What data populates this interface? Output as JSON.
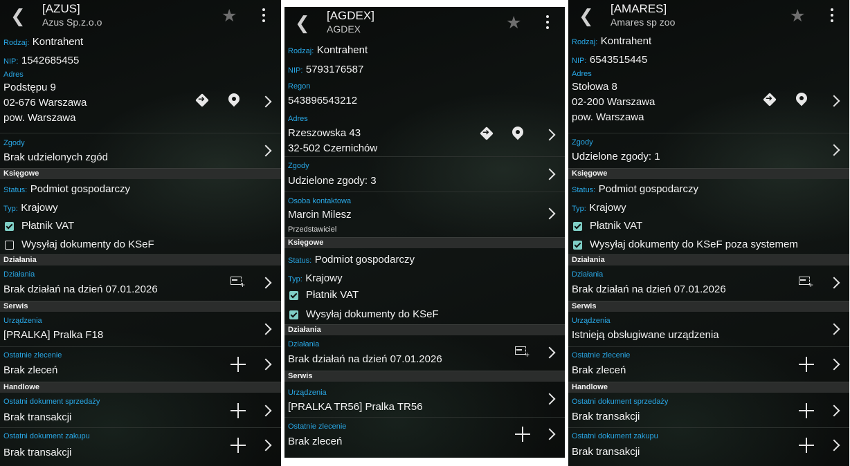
{
  "panels": [
    {
      "code": "[AZUS]",
      "name": "Azus Sp.z.o.o",
      "rodzaj_label": "Rodzaj:",
      "rodzaj": "Kontrahent",
      "nip_label": "NIP:",
      "nip": "1542685455",
      "adres_label": "Adres",
      "adres": [
        "Podstępu 9",
        "02-676 Warszawa",
        "pow. Warszawa"
      ],
      "zgody_label": "Zgody",
      "zgody": "Brak udzielonych zgód",
      "ksiegowe_header": "Księgowe",
      "status_label": "Status:",
      "status": "Podmiot gospodarczy",
      "typ_label": "Typ:",
      "typ": "Krajowy",
      "checkboxes": [
        {
          "label": "Płatnik VAT",
          "checked": true
        },
        {
          "label": "Wysyłaj dokumenty do KSeF",
          "checked": false
        }
      ],
      "dzialania_header": "Działania",
      "dzialania_label": "Działania",
      "dzialania": "Brak działań na dzień 07.01.2026",
      "serwis_header": "Serwis",
      "urzadzenia_label": "Urządzenia",
      "urzadzenia": "[PRALKA] Pralka F18",
      "zlecenie_label": "Ostatnie zlecenie",
      "zlecenie": "Brak zleceń",
      "handlowe_header": "Handlowe",
      "sprzedaz_label": "Ostatni dokument sprzedaży",
      "sprzedaz": "Brak transakcji",
      "zakup_label": "Ostatni dokument zakupu",
      "zakup": "Brak transakcji"
    },
    {
      "code": "[AGDEX]",
      "name": "AGDEX",
      "rodzaj_label": "Rodzaj:",
      "rodzaj": "Kontrahent",
      "nip_label": "NIP:",
      "nip": "5793176587",
      "regon_label": "Regon",
      "regon": "543896543212",
      "adres_label": "Adres",
      "adres": [
        "Rzeszowska 43",
        "32-502 Czernichów"
      ],
      "zgody_label": "Zgody",
      "zgody": "Udzielone zgody: 3",
      "osoba_label": "Osoba kontaktowa",
      "osoba": "Marcin Milesz",
      "osoba_rola": "Przedstawiciel",
      "ksiegowe_header": "Księgowe",
      "status_label": "Status:",
      "status": "Podmiot gospodarczy",
      "typ_label": "Typ:",
      "typ": "Krajowy",
      "checkboxes": [
        {
          "label": "Płatnik VAT",
          "checked": true
        },
        {
          "label": "Wysyłaj dokumenty do KSeF",
          "checked": true
        }
      ],
      "dzialania_header": "Działania",
      "dzialania_label": "Działania",
      "dzialania": "Brak działań na dzień 07.01.2026",
      "serwis_header": "Serwis",
      "urzadzenia_label": "Urządzenia",
      "urzadzenia": "[PRALKA TR56] Pralka TR56",
      "zlecenie_label": "Ostatnie zlecenie",
      "zlecenie": "Brak zleceń"
    },
    {
      "code": "[AMARES]",
      "name": "Amares sp zoo",
      "rodzaj_label": "Rodzaj:",
      "rodzaj": "Kontrahent",
      "nip_label": "NIP:",
      "nip": "6543515445",
      "adres_label": "Adres",
      "adres": [
        "Stołowa 8",
        "02-200 Warszawa",
        "pow. Warszawa"
      ],
      "zgody_label": "Zgody",
      "zgody": "Udzielone zgody: 1",
      "ksiegowe_header": "Księgowe",
      "status_label": "Status:",
      "status": "Podmiot gospodarczy",
      "typ_label": "Typ:",
      "typ": "Krajowy",
      "checkboxes": [
        {
          "label": "Płatnik VAT",
          "checked": true
        },
        {
          "label": "Wysyłaj dokumenty do KSeF poza systemem",
          "checked": true
        }
      ],
      "dzialania_header": "Działania",
      "dzialania_label": "Działania",
      "dzialania": "Brak działań na dzień 07.01.2026",
      "serwis_header": "Serwis",
      "urzadzenia_label": "Urządzenia",
      "urzadzenia": "Istnieją obsługiwane urządzenia",
      "zlecenie_label": "Ostatnie zlecenie",
      "zlecenie": "Brak zleceń",
      "handlowe_header": "Handlowe",
      "sprzedaz_label": "Ostatni dokument sprzedaży",
      "sprzedaz": "Brak transakcji",
      "zakup_label": "Ostatni dokument zakupu",
      "zakup": "Brak transakcji"
    }
  ],
  "icons": {
    "back": "chevron-left-icon",
    "favorite": "star-icon",
    "menu": "more-vertical-icon",
    "navigate": "navigation-icon",
    "map": "map-pin-icon",
    "open": "chevron-right-icon",
    "add": "plus-icon",
    "add_activity": "add-activity-icon"
  },
  "colors": {
    "label_blue": "#29a7e5",
    "checkbox_teal": "#7fcfc6",
    "section_bg": "#2b2d2c"
  }
}
